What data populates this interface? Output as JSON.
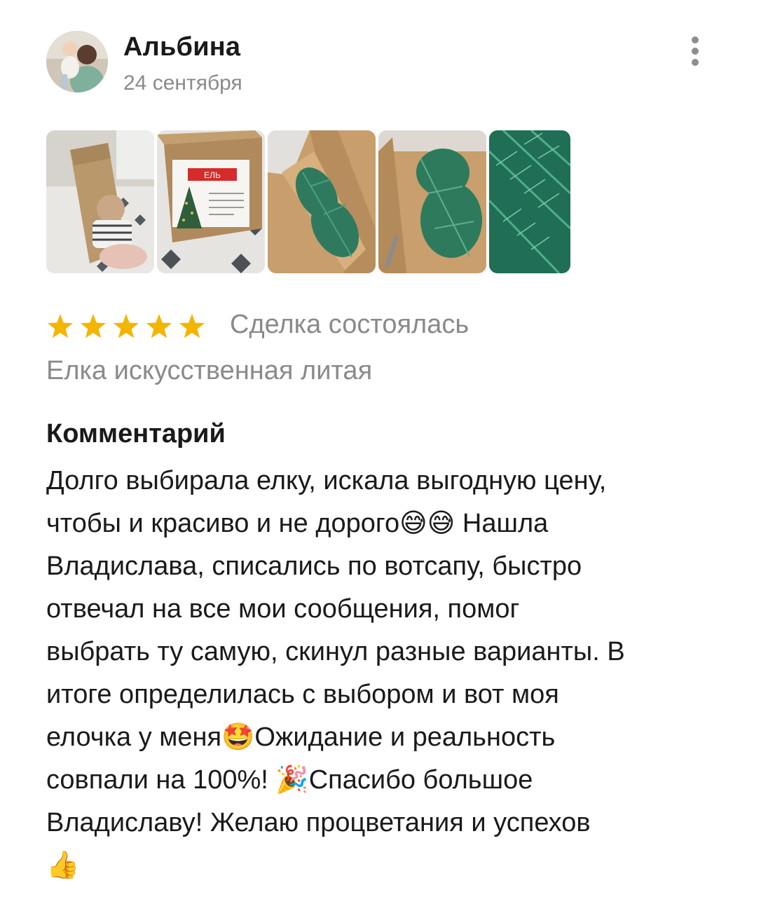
{
  "review": {
    "author": "Альбина",
    "date": "24 сентября",
    "avatar_icon": "user-photo-avatar",
    "more_icon": "more-vertical-icon",
    "photos": [
      {
        "label": "box-with-child"
      },
      {
        "label": "box-with-product-label",
        "box_label": "ЕЛЬ"
      },
      {
        "label": "tree-in-box"
      },
      {
        "label": "tree-in-box-side"
      },
      {
        "label": "needles-closeup"
      }
    ],
    "rating": 5,
    "rating_icon": "star-icon",
    "star_color": "#f5b400",
    "deal_status": "Сделка состоялась",
    "product": "Елка искусственная литая",
    "comment_heading": "Комментарий",
    "comment_lines": [
      "Долго выбирала елку, искала выгодную цену,",
      "чтобы и красиво и не дорого😅😅 Нашла",
      "Владислава, списались по вотсапу, быстро",
      "отвечал на все мои сообщения, помог",
      "выбрать ту самую, скинул разные варианты. В",
      "итоге определилась с выбором и вот моя",
      "елочка у меня🤩Ожидание и реальность",
      "совпали на 100%! 🎉Спасибо большое",
      "Владиславу! Желаю процветания и успехов",
      "👍"
    ]
  }
}
